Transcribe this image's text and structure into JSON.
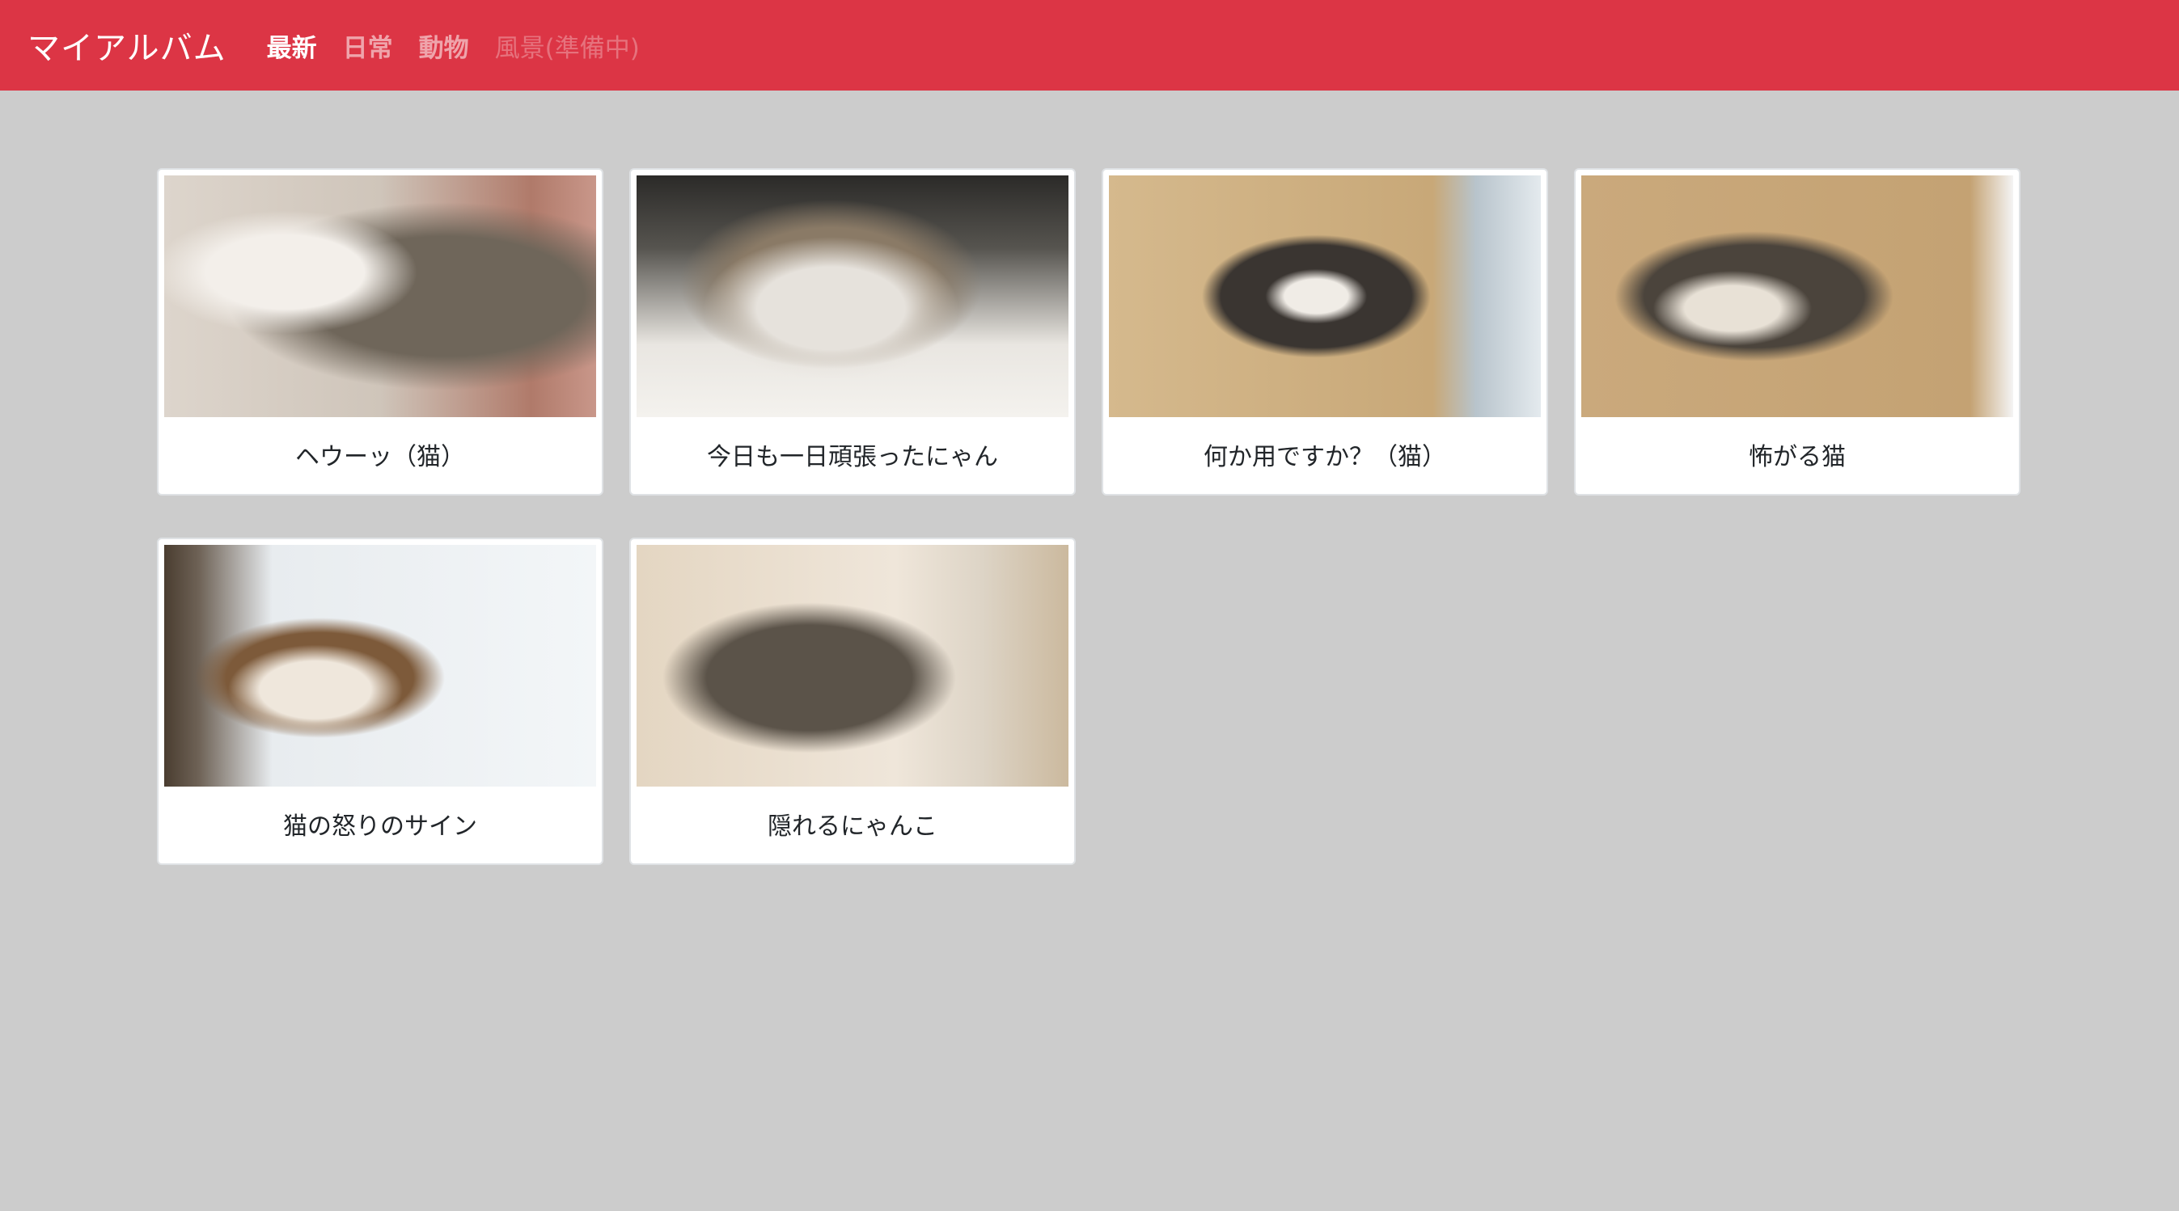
{
  "navbar": {
    "brand": "マイアルバム",
    "items": [
      {
        "label": "最新",
        "state": "active"
      },
      {
        "label": "日常",
        "state": "normal"
      },
      {
        "label": "動物",
        "state": "normal"
      },
      {
        "label": "風景(準備中)",
        "state": "disabled"
      }
    ]
  },
  "album": {
    "photos": [
      {
        "caption": "ヘウーッ（猫）"
      },
      {
        "caption": "今日も一日頑張ったにゃん"
      },
      {
        "caption": "何か用ですか？（猫）"
      },
      {
        "caption": "怖がる猫"
      },
      {
        "caption": "猫の怒りのサイン"
      },
      {
        "caption": "隠れるにゃんこ"
      }
    ]
  },
  "colors": {
    "navbar": "#dc3545",
    "background": "#cccccc"
  }
}
